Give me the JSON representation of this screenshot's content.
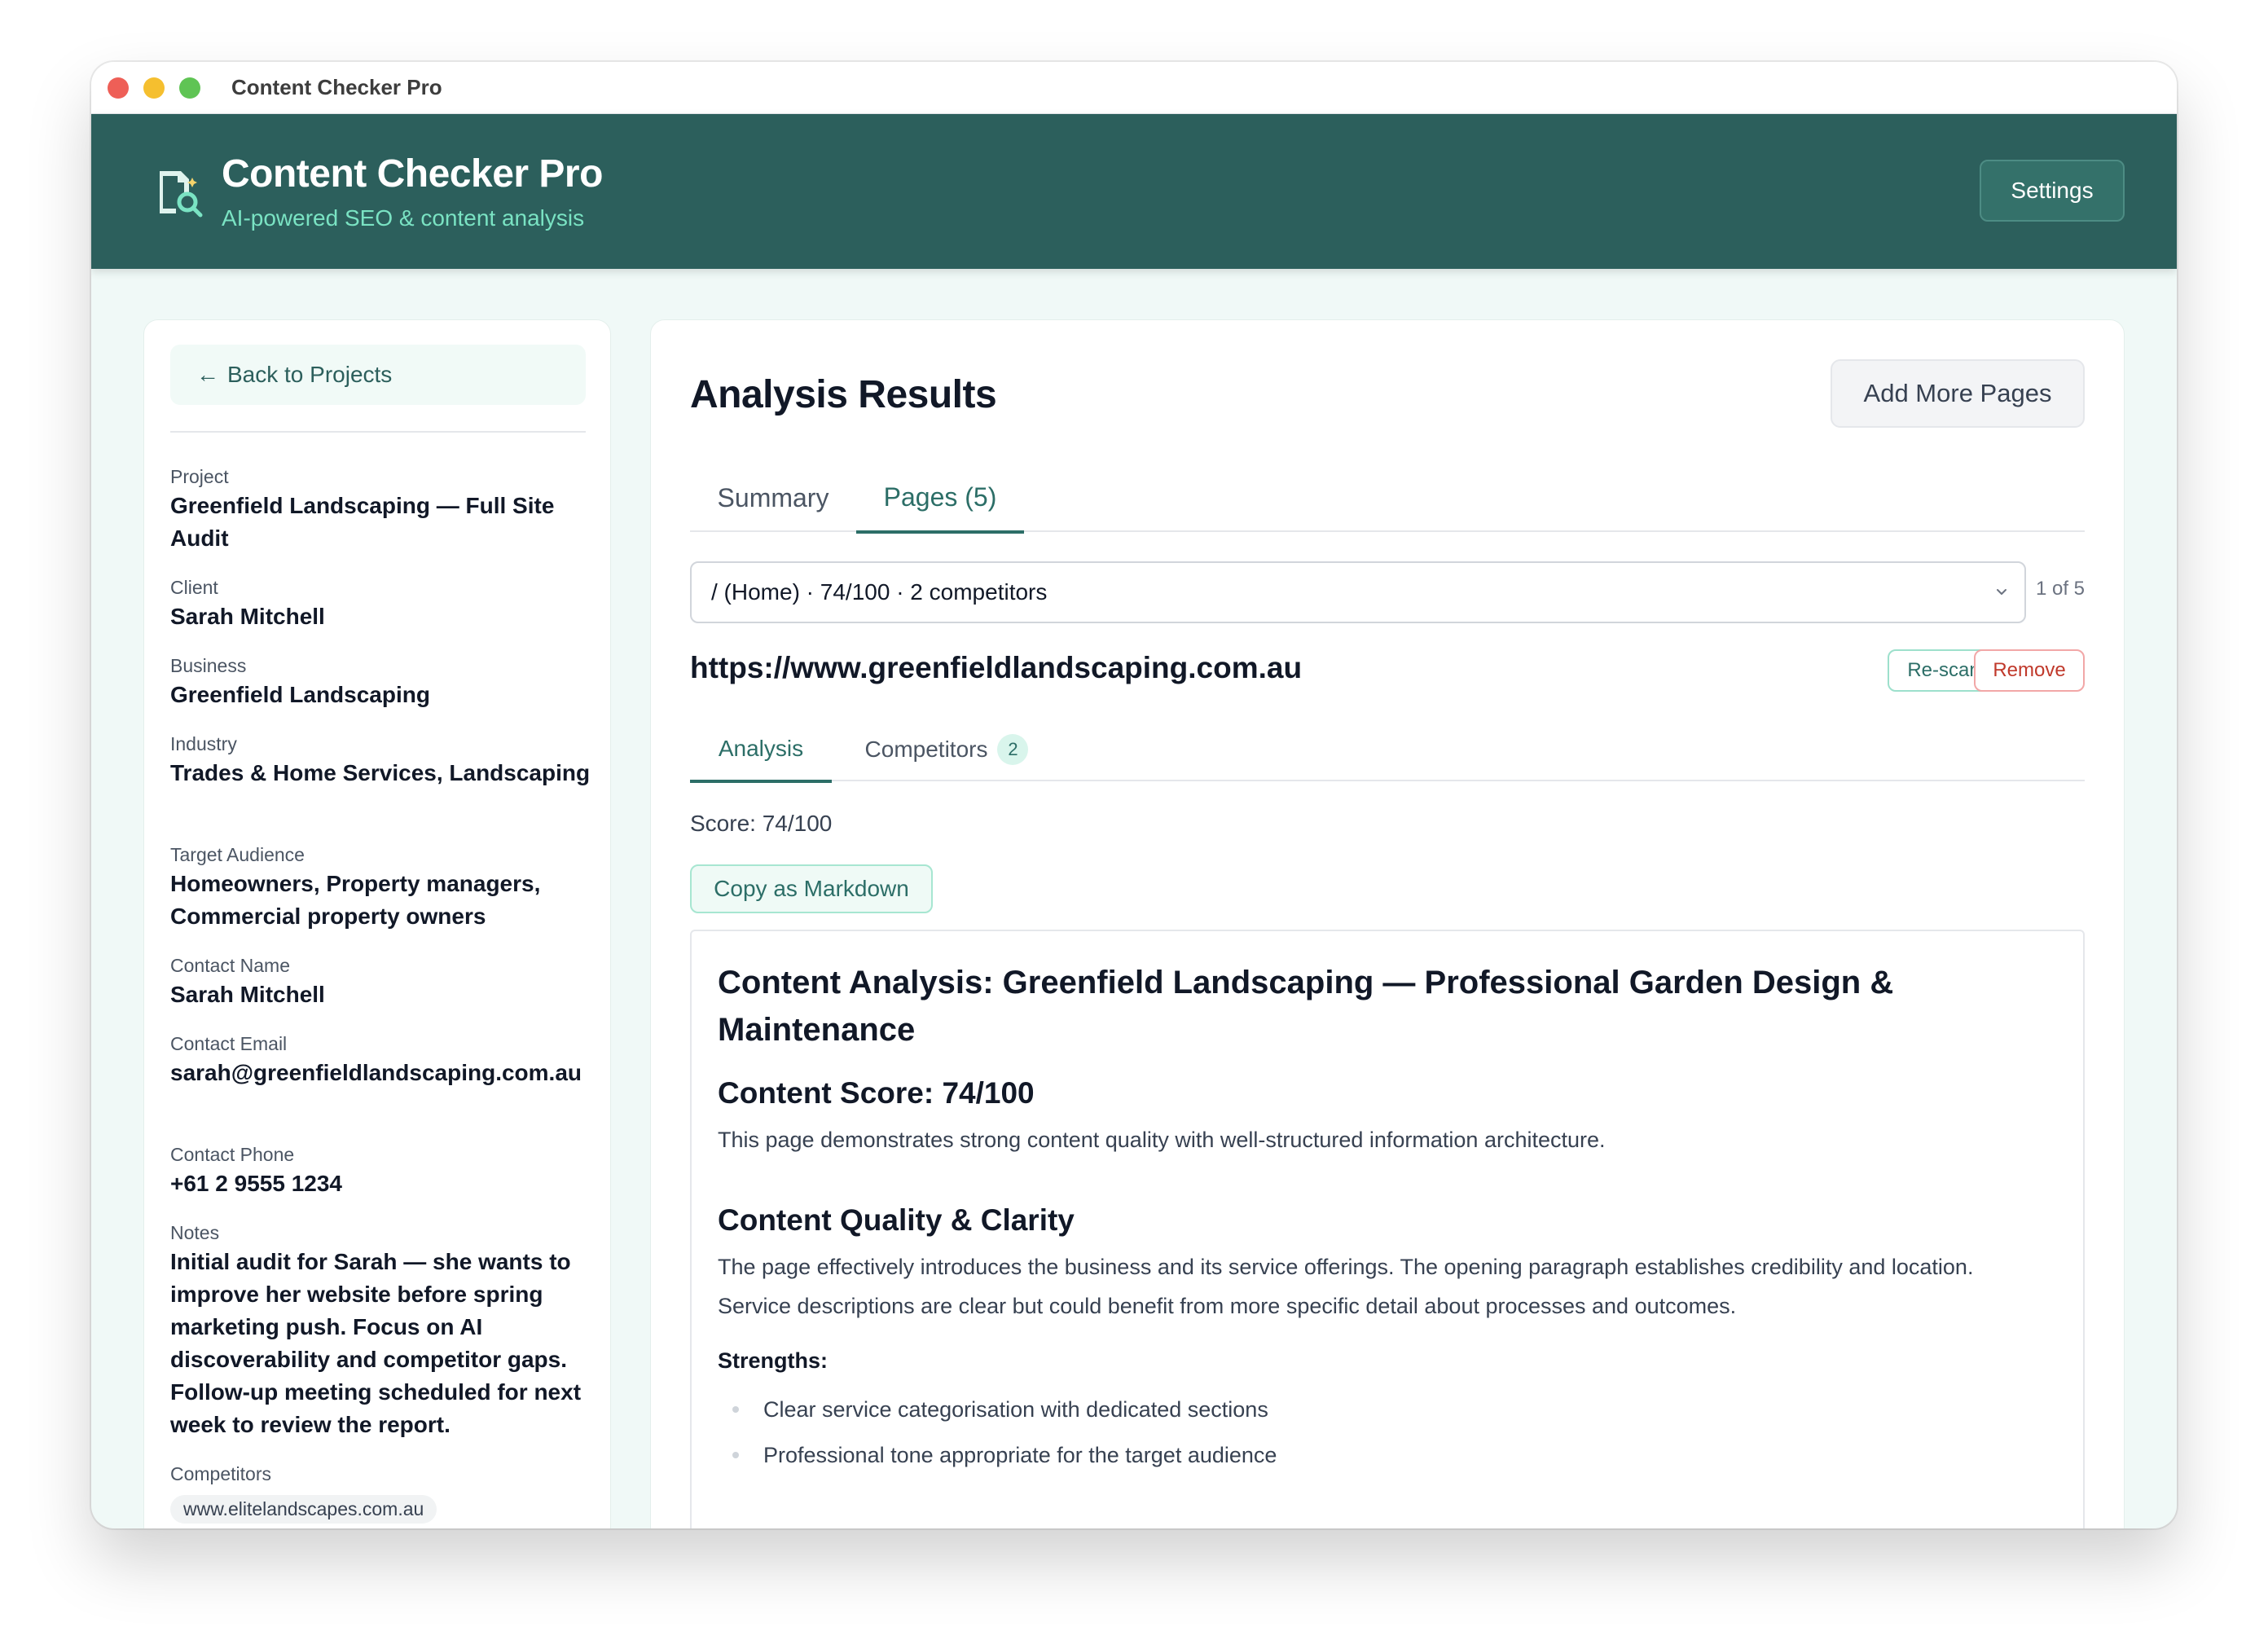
{
  "window": {
    "title": "Content Checker Pro"
  },
  "header": {
    "title": "Content Checker Pro",
    "subtitle": "AI-powered SEO & content analysis",
    "settings_label": "Settings"
  },
  "sidebar": {
    "back_label": "Back to Projects",
    "fields": [
      {
        "label": "Project",
        "value": "Greenfield Landscaping — Full Site Audit"
      },
      {
        "label": "Client",
        "value": "Sarah Mitchell"
      },
      {
        "label": "Business",
        "value": "Greenfield Landscaping"
      },
      {
        "label": "Industry",
        "value": "Trades & Home Services, Landscaping"
      },
      {
        "label": "Target Audience",
        "value": "Homeowners, Property managers, Commercial property owners"
      },
      {
        "label": "Contact Name",
        "value": "Sarah Mitchell"
      },
      {
        "label": "Contact Email",
        "value": "sarah@greenfieldlandscaping.com.au"
      },
      {
        "label": "Contact Phone",
        "value": "+61 2 9555 1234"
      },
      {
        "label": "Notes",
        "value": "Initial audit for Sarah — she wants to improve her website before spring marketing push. Focus on AI discoverability and competitor gaps. Follow-up meeting scheduled for next week to review the report."
      },
      {
        "label": "Competitors",
        "value": "www.elitelandscapes.com.au"
      }
    ]
  },
  "main": {
    "title": "Analysis Results",
    "add_pages_label": "Add More Pages",
    "tabs": [
      {
        "label": "Summary",
        "active": false
      },
      {
        "label": "Pages (5)",
        "active": true
      }
    ],
    "page_select": {
      "selected": "/ (Home) · 74/100 · 2 competitors",
      "position": "1 of 5"
    },
    "page_url": "https://www.greenfieldlandscaping.com.au",
    "rescan_label": "Re-scan",
    "remove_label": "Remove",
    "subtabs": [
      {
        "label": "Analysis",
        "active": true
      },
      {
        "label": "Competitors",
        "active": false,
        "badge": "2"
      }
    ],
    "score_text": "Score: 74/100",
    "copy_markdown_label": "Copy as Markdown",
    "report": {
      "h1": "Content Analysis: Greenfield Landscaping — Professional Garden Design & Maintenance",
      "score_heading": "Content Score: 74/100",
      "intro": "This page demonstrates strong content quality with well-structured information architecture.",
      "section_heading": "Content Quality & Clarity",
      "section_body": "The page effectively introduces the business and its service offerings. The opening paragraph establishes credibility and location. Service descriptions are clear but could benefit from more specific detail about processes and outcomes.",
      "strengths_label": "Strengths:",
      "strengths": [
        "Clear service categorisation with dedicated sections",
        "Professional tone appropriate for the target audience"
      ]
    }
  },
  "colors": {
    "header_bg": "#2c5f5c",
    "accent": "#2c6e67",
    "subtitle": "#7ae3c3",
    "danger": "#c0392b"
  }
}
